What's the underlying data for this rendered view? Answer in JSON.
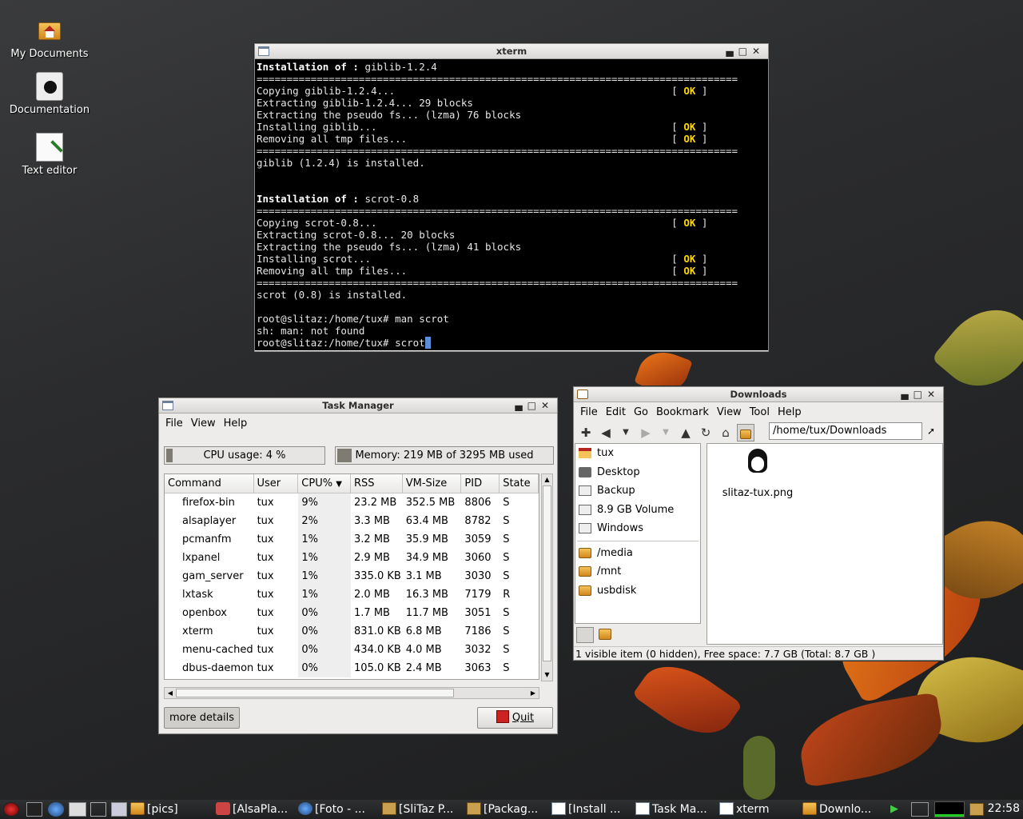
{
  "desktop": {
    "icons": [
      {
        "label": "My Documents"
      },
      {
        "label": "Documentation"
      },
      {
        "label": "Text editor"
      }
    ]
  },
  "xterm": {
    "title": "xterm",
    "lines": [
      {
        "bold": "Installation of :",
        "text": " giblib-1.2.4"
      },
      {
        "text": "================================================================================"
      },
      {
        "text": "Copying giblib-1.2.4...",
        "ok": "OK"
      },
      {
        "text": "Extracting giblib-1.2.4... 29 blocks"
      },
      {
        "text": "Extracting the pseudo fs... (lzma) 76 blocks"
      },
      {
        "text": "Installing giblib...",
        "ok": "OK"
      },
      {
        "text": "Removing all tmp files...",
        "ok": "OK"
      },
      {
        "text": "================================================================================"
      },
      {
        "text": "giblib (1.2.4) is installed."
      },
      {
        "text": ""
      },
      {
        "text": ""
      },
      {
        "bold": "Installation of :",
        "text": " scrot-0.8"
      },
      {
        "text": "================================================================================"
      },
      {
        "text": "Copying scrot-0.8...",
        "ok": "OK"
      },
      {
        "text": "Extracting scrot-0.8... 20 blocks"
      },
      {
        "text": "Extracting the pseudo fs... (lzma) 41 blocks"
      },
      {
        "text": "Installing scrot...",
        "ok": "OK"
      },
      {
        "text": "Removing all tmp files...",
        "ok": "OK"
      },
      {
        "text": "================================================================================"
      },
      {
        "text": "scrot (0.8) is installed."
      },
      {
        "text": ""
      },
      {
        "text": "root@slitaz:/home/tux# man scrot"
      },
      {
        "text": "sh: man: not found"
      },
      {
        "text": "root@slitaz:/home/tux# scrot",
        "cursor": true
      }
    ]
  },
  "taskmanager": {
    "title": "Task Manager",
    "menu": [
      "File",
      "View",
      "Help"
    ],
    "cpu_label": "CPU usage: 4 %",
    "cpu_fraction": 0.04,
    "mem_label": "Memory: 219 MB of 3295 MB used",
    "mem_fraction": 0.066,
    "columns": [
      "Command",
      "User",
      "CPU%",
      "RSS",
      "VM-Size",
      "PID",
      "State"
    ],
    "rows": [
      [
        "firefox-bin",
        "tux",
        "9%",
        "23.2 MB",
        "352.5 MB",
        "8806",
        "S"
      ],
      [
        "alsaplayer",
        "tux",
        "2%",
        "3.3 MB",
        "63.4 MB",
        "8782",
        "S"
      ],
      [
        "pcmanfm",
        "tux",
        "1%",
        "3.2 MB",
        "35.9 MB",
        "3059",
        "S"
      ],
      [
        "lxpanel",
        "tux",
        "1%",
        "2.9 MB",
        "34.9 MB",
        "3060",
        "S"
      ],
      [
        "gam_server",
        "tux",
        "1%",
        "335.0 KB",
        "3.1 MB",
        "3030",
        "S"
      ],
      [
        "lxtask",
        "tux",
        "1%",
        "2.0 MB",
        "16.3 MB",
        "7179",
        "R"
      ],
      [
        "openbox",
        "tux",
        "0%",
        "1.7 MB",
        "11.7 MB",
        "3051",
        "S"
      ],
      [
        "xterm",
        "tux",
        "0%",
        "831.0 KB",
        "6.8 MB",
        "7186",
        "S"
      ],
      [
        "menu-cached",
        "tux",
        "0%",
        "434.0 KB",
        "4.0 MB",
        "3032",
        "S"
      ],
      [
        "dbus-daemon",
        "tux",
        "0%",
        "105.0 KB",
        "2.4 MB",
        "3063",
        "S"
      ]
    ],
    "more_details": "more details",
    "quit": "Quit"
  },
  "filemanager": {
    "title": "Downloads",
    "menu": [
      "File",
      "Edit",
      "Go",
      "Bookmark",
      "View",
      "Tool",
      "Help"
    ],
    "path": "/home/tux/Downloads",
    "places": [
      "tux",
      "Desktop",
      "Backup",
      "8.9 GB Volume",
      "Windows"
    ],
    "bookmarks": [
      "/media",
      "/mnt",
      "usbdisk"
    ],
    "files": [
      {
        "name": "slitaz-tux.png"
      }
    ],
    "status": "1 visible item (0 hidden), Free space: 7.7 GB (Total: 8.7 GB )"
  },
  "taskbar": {
    "items": [
      {
        "label": "[pics]",
        "icon": "folder-icon"
      },
      {
        "label": "[AlsaPla...",
        "icon": "music-icon"
      },
      {
        "label": "[Foto - ...",
        "icon": "globe-icon"
      },
      {
        "label": "[SliTaz P...",
        "icon": "package-icon"
      },
      {
        "label": "[Packag...",
        "icon": "package-icon"
      },
      {
        "label": "[Install ...",
        "icon": "window-icon"
      },
      {
        "label": "Task Ma...",
        "icon": "window-icon"
      },
      {
        "label": "xterm",
        "icon": "window-icon"
      },
      {
        "label": "Downlo...",
        "icon": "folder-icon"
      }
    ],
    "clock": "22:58"
  },
  "colors": {
    "ok": "#ffd700",
    "cursor": "#5b8ed8",
    "folder": "#e0a030"
  }
}
